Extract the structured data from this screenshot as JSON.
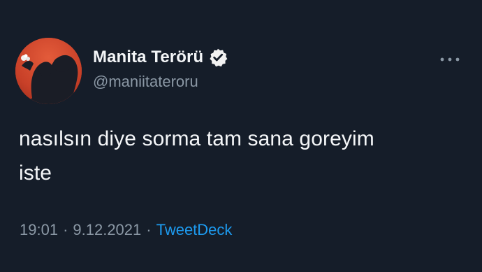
{
  "theme": {
    "background": "#151d29",
    "text_primary": "#f4f6f8",
    "text_secondary": "#8b98a5",
    "link": "#1d9bf0"
  },
  "author": {
    "display_name": "Manita Terörü",
    "handle": "@maniitateroru",
    "verified": true,
    "avatar_icon": "profile-photo",
    "badge_icon": "verified-badge-icon"
  },
  "tweet": {
    "text": "nasılsın diye sorma tam sana goreyim\niste",
    "time": "19:01",
    "separator": "·",
    "date": "9.12.2021",
    "source": "TweetDeck"
  },
  "actions": {
    "more_icon": "more-options-icon"
  }
}
